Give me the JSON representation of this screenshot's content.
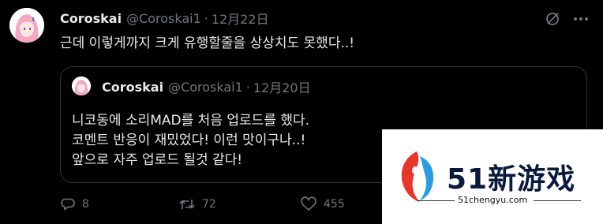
{
  "tweet": {
    "display_name": "Coroskai",
    "handle": "@Coroskai1",
    "separator": "·",
    "time": "12月22日",
    "text": "근데 이렇게까지 크게 유행할줄을 상상치도 못했다..!"
  },
  "quote": {
    "display_name": "Coroskai",
    "handle": "@Coroskai1",
    "separator": "·",
    "time": "12月20日",
    "lines": [
      "니코동에 소리MAD를 처음 업로드를 했다.",
      "코멘트 반응이 재밌었다! 이런 맛이구나..!",
      "앞으로 자주 업로드 될것 같다!"
    ]
  },
  "actions": {
    "reply_count": "8",
    "retweet_count": "72",
    "like_count": "455"
  },
  "watermark": {
    "title": "51新游戏",
    "url": "51chengyu.com"
  },
  "icons": {
    "grok": "grok-icon",
    "more": "more-icon",
    "reply": "reply-icon",
    "retweet": "retweet-icon",
    "like": "heart-icon",
    "logo": "brand-logo-icon"
  },
  "colors": {
    "background": "#000000",
    "text_primary": "#e7e9ea",
    "text_secondary": "#71767b",
    "border": "#2f3336",
    "avatar_hair": "#f2a7c3",
    "logo_red": "#e8362b",
    "logo_blue": "#2a9de0"
  }
}
